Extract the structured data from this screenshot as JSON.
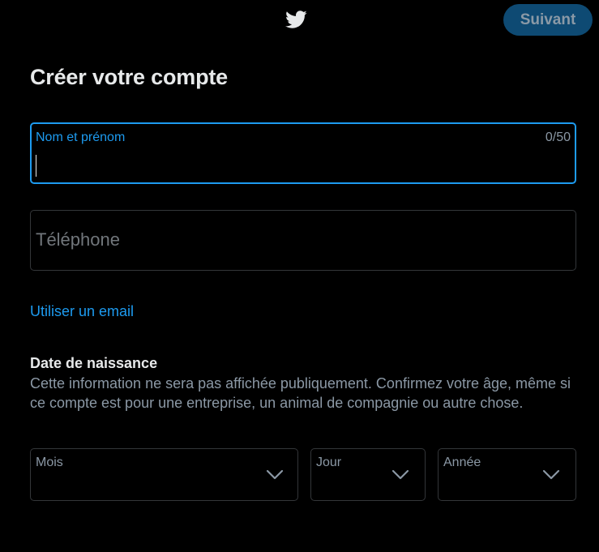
{
  "header": {
    "logo_icon": "twitter-bird-icon",
    "next_label": "Suivant"
  },
  "page_title": "Créer votre compte",
  "name_field": {
    "label": "Nom et prénom",
    "counter": "0/50",
    "value": ""
  },
  "phone_field": {
    "placeholder": "Téléphone",
    "value": ""
  },
  "email_link": "Utiliser un email",
  "birthdate": {
    "title": "Date de naissance",
    "description": "Cette information ne sera pas affichée publiquement. Confirmez votre âge, même si ce compte est pour une entreprise, un animal de compagnie ou autre chose.",
    "month_label": "Mois",
    "day_label": "Jour",
    "year_label": "Année"
  },
  "colors": {
    "background": "#000000",
    "accent": "#1d9bf0",
    "button_disabled_bg": "#0e4a73",
    "muted_text": "#8b98a5",
    "border": "#333639"
  }
}
